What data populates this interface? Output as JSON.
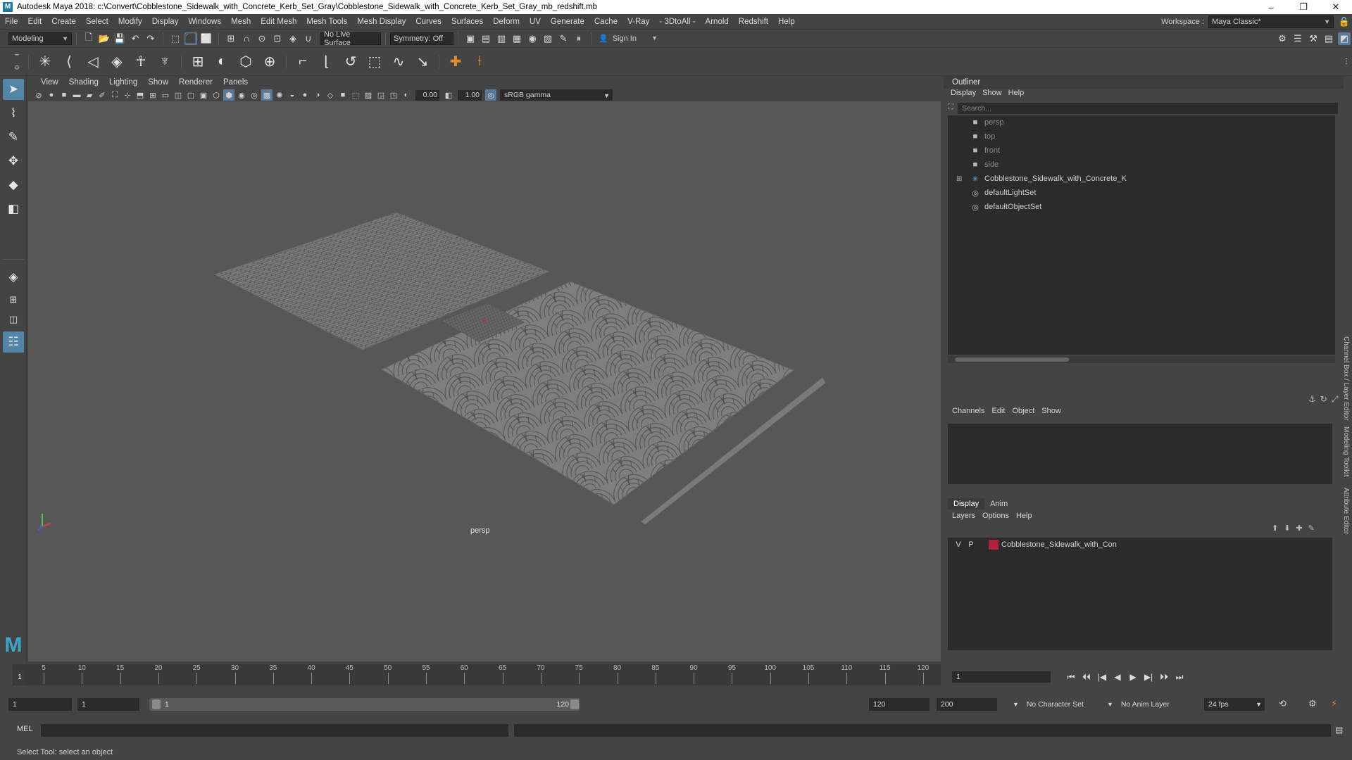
{
  "window": {
    "title": "Autodesk Maya 2018: c:\\Convert\\Cobblestone_Sidewalk_with_Concrete_Kerb_Set_Gray\\Cobblestone_Sidewalk_with_Concrete_Kerb_Set_Gray_mb_redshift.mb",
    "logo": "M",
    "minimize": "–",
    "maximize": "❐",
    "close": "✕"
  },
  "menubar": {
    "items": [
      "File",
      "Edit",
      "Create",
      "Select",
      "Modify",
      "Display",
      "Windows",
      "Mesh",
      "Edit Mesh",
      "Mesh Tools",
      "Mesh Display",
      "Curves",
      "Surfaces",
      "Deform",
      "UV",
      "Generate",
      "Cache",
      "V-Ray",
      "- 3DtoAll -",
      "Arnold",
      "Redshift",
      "Help"
    ],
    "workspace_label": "Workspace :",
    "workspace_value": "Maya Classic*"
  },
  "statusline": {
    "menu_set": "Modeling",
    "live_surface": "No Live Surface",
    "symmetry": "Symmetry: Off",
    "sign_in": "Sign In"
  },
  "viewport": {
    "menus": [
      "View",
      "Shading",
      "Lighting",
      "Show",
      "Renderer",
      "Panels"
    ],
    "exposure": "0.00",
    "gamma": "1.00",
    "color_space": "sRGB gamma",
    "camera_label": "persp"
  },
  "outliner": {
    "title": "Outliner",
    "menus": [
      "Display",
      "Show",
      "Help"
    ],
    "search_placeholder": "Search...",
    "items": [
      {
        "label": "persp",
        "icon": "camera-icon"
      },
      {
        "label": "top",
        "icon": "camera-icon"
      },
      {
        "label": "front",
        "icon": "camera-icon"
      },
      {
        "label": "side",
        "icon": "camera-icon"
      },
      {
        "label": "Cobblestone_Sidewalk_with_Concrete_K",
        "icon": "group-icon",
        "expander": "⊞"
      },
      {
        "label": "defaultLightSet",
        "icon": "set-icon"
      },
      {
        "label": "defaultObjectSet",
        "icon": "set-icon"
      }
    ]
  },
  "channelbox": {
    "menus": [
      "Channels",
      "Edit",
      "Object",
      "Show"
    ]
  },
  "layereditor": {
    "tabs": [
      "Display",
      "Anim"
    ],
    "menus": [
      "Layers",
      "Options",
      "Help"
    ],
    "layers": [
      {
        "v": "V",
        "p": "P",
        "name": "Cobblestone_Sidewalk_with_Con",
        "color": "#b3203a"
      }
    ]
  },
  "sidetabs": {
    "channel_box": "Channel Box / Layer Editor",
    "modeling_toolkit": "Modeling Toolkit",
    "attribute_editor": "Attribute Editor"
  },
  "timeslider": {
    "ticks": [
      "5",
      "10",
      "15",
      "20",
      "25",
      "30",
      "35",
      "40",
      "45",
      "50",
      "55",
      "60",
      "65",
      "70",
      "75",
      "80",
      "85",
      "90",
      "95",
      "100",
      "105",
      "110",
      "115",
      "120"
    ],
    "current_frame_marker": "1",
    "current_frame": "1",
    "playback_icons": [
      "⏮",
      "⏴⏴",
      "|◀",
      "◀",
      "▶",
      "▶|",
      "⏵⏵",
      "⏭"
    ]
  },
  "rangeslider": {
    "start": "1",
    "playback_start": "1",
    "range_start_label": "1",
    "range_end_label": "120",
    "playback_end": "120",
    "end": "200",
    "character_set": "No Character Set",
    "anim_layer": "No Anim Layer",
    "fps": "24 fps"
  },
  "cmdline": {
    "language": "MEL"
  },
  "helpline": {
    "text": "Select Tool: select an object"
  },
  "colors": {
    "accent": "#5285a6",
    "layer_swatch": "#b3203a",
    "viewport_bg": "#575757"
  }
}
